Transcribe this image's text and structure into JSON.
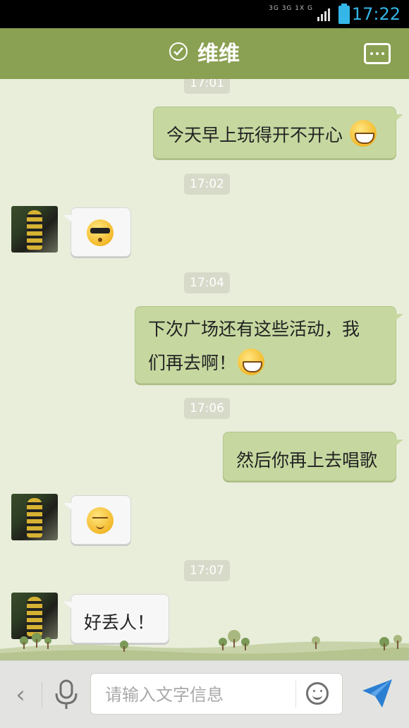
{
  "status_bar": {
    "time": "17:22",
    "network_line1": "3G 3G 1X G",
    "battery_color": "#34b6e8"
  },
  "header": {
    "title": "维维",
    "background": "#8aa052",
    "check_icon": "check-circle-icon",
    "more_icon": "more-dots-icon"
  },
  "chat": {
    "timestamps": [
      "17:01",
      "17:02",
      "17:04",
      "17:06",
      "17:07"
    ],
    "messages": [
      {
        "direction": "out",
        "text": "今天早上玩得开不开心",
        "emoji": "grin-emoji-icon"
      },
      {
        "direction": "in",
        "text": "",
        "emoji": "cool-sunglasses-emoji-icon"
      },
      {
        "direction": "out",
        "text_line1": "下次广场还有这些活动，我",
        "text_line2": "们再去啊！",
        "emoji": "grin-emoji-icon"
      },
      {
        "direction": "out",
        "text": "然后你再上去唱歌"
      },
      {
        "direction": "in",
        "text": "",
        "emoji": "shy-emoji-icon"
      },
      {
        "direction": "in",
        "text": "好丢人！"
      }
    ]
  },
  "input_bar": {
    "back_glyph": "‹",
    "placeholder": "请输入文字信息",
    "value": "",
    "mic_icon": "microphone-icon",
    "emoji_icon": "smiley-icon",
    "send_icon": "send-paper-plane-icon",
    "send_color": "#2b7fd3"
  }
}
